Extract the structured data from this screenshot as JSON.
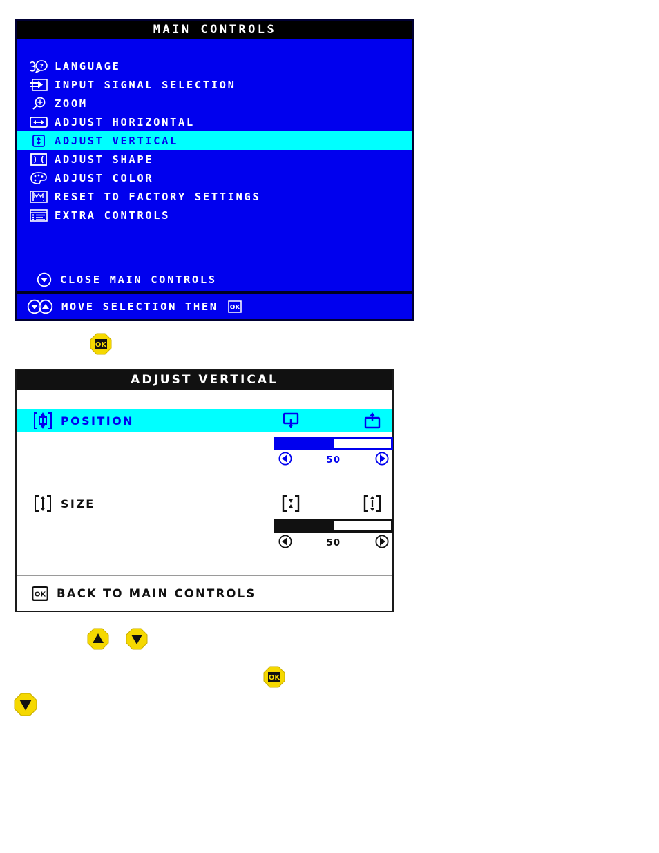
{
  "main_controls": {
    "title": "MAIN CONTROLS",
    "items": [
      {
        "icon": "language-icon",
        "label": "LANGUAGE",
        "selected": false
      },
      {
        "icon": "input-signal-icon",
        "label": "INPUT SIGNAL SELECTION",
        "selected": false
      },
      {
        "icon": "zoom-icon",
        "label": "ZOOM",
        "selected": false
      },
      {
        "icon": "adjust-horizontal-icon",
        "label": "ADJUST HORIZONTAL",
        "selected": false
      },
      {
        "icon": "adjust-vertical-icon",
        "label": "ADJUST VERTICAL",
        "selected": true
      },
      {
        "icon": "adjust-shape-icon",
        "label": "ADJUST SHAPE",
        "selected": false
      },
      {
        "icon": "adjust-color-icon",
        "label": "ADJUST COLOR",
        "selected": false
      },
      {
        "icon": "reset-factory-icon",
        "label": "RESET TO FACTORY SETTINGS",
        "selected": false
      },
      {
        "icon": "extra-controls-icon",
        "label": "EXTRA CONTROLS",
        "selected": false
      }
    ],
    "close_item": {
      "icon": "down-arrow-circle-icon",
      "label": "CLOSE MAIN CONTROLS"
    },
    "footer": {
      "icons": "down-up-arrow-circle-icons",
      "label": "MOVE SELECTION THEN",
      "ok_icon": "ok-icon"
    },
    "colors": {
      "background": "#0000ee",
      "titlebar": "#000000",
      "border": "#000033",
      "highlight": "#00ffff",
      "text": "#ffffff",
      "highlight_text": "#0000ee"
    }
  },
  "adjust_vertical": {
    "title": "ADJUST VERTICAL",
    "rows": [
      {
        "icon": "vertical-position-icon",
        "label": "POSITION",
        "selected": true,
        "icon_left": "position-down-icon",
        "icon_right": "position-up-icon",
        "value": "50",
        "fill_percent": 50,
        "left_arrow": "left-arrow-circle-icon",
        "right_arrow": "right-arrow-circle-icon"
      },
      {
        "icon": "vertical-size-icon",
        "label": "SIZE",
        "selected": false,
        "icon_left": "size-shrink-icon",
        "icon_right": "size-grow-icon",
        "value": "50",
        "fill_percent": 50,
        "left_arrow": "left-arrow-circle-icon",
        "right_arrow": "right-arrow-circle-icon"
      }
    ],
    "footer": {
      "icon": "ok-icon",
      "label": "BACK TO MAIN CONTROLS"
    },
    "colors": {
      "background": "#ffffff",
      "titlebar": "#111111",
      "border": "#1a1a1a",
      "highlight": "#00ffff",
      "text": "#111111",
      "highlight_text": "#0000ee"
    }
  },
  "buttons": [
    {
      "name": "ok-button-1",
      "icon": "ok-icon",
      "color": "#f5d800"
    },
    {
      "name": "up-button",
      "icon": "up-arrow-icon",
      "color": "#f5d800"
    },
    {
      "name": "down-button",
      "icon": "down-arrow-icon",
      "color": "#f5d800"
    },
    {
      "name": "ok-button-2",
      "icon": "ok-icon",
      "color": "#f5d800"
    },
    {
      "name": "down-button-2",
      "icon": "down-arrow-icon",
      "color": "#f5d800"
    }
  ]
}
